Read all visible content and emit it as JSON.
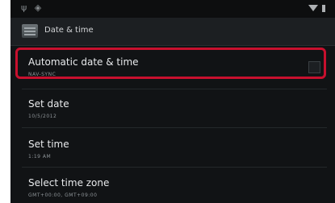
{
  "status_bar": {
    "left_icons": "ψ ◈",
    "right_icons": [
      "wifi-icon",
      "battery-icon"
    ]
  },
  "action_bar": {
    "title": "Date & time",
    "icon": "settings-app-icon"
  },
  "settings": [
    {
      "title": "Automatic date & time",
      "summary": "NAV-SYNC",
      "checkbox": true,
      "highlighted": true
    },
    {
      "title": "Set date",
      "summary": "10/5/2012"
    },
    {
      "title": "Set time",
      "summary": "1:19 AM"
    },
    {
      "title": "Select time zone",
      "summary": "GMT+00:00, GMT+09:00"
    }
  ],
  "colors": {
    "background": "#111315",
    "highlight": "#c8102e",
    "title_text": "#e8eaec",
    "summary_text": "#8e9498"
  }
}
